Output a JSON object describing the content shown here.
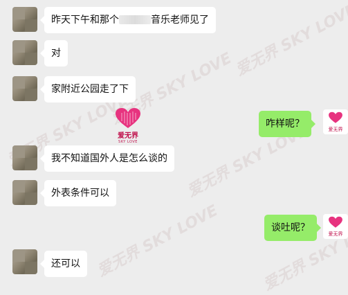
{
  "watermark": {
    "brand_cn": "爱无界",
    "brand_en": "SKY LOVE"
  },
  "center_logo": {
    "title": "爱无界",
    "subtitle": "SKY LOVE"
  },
  "messages": [
    {
      "side": "left",
      "text_before": "昨天下午和那个",
      "redacted": true,
      "text_after": "音乐老师见了"
    },
    {
      "side": "left",
      "text": "对"
    },
    {
      "side": "left",
      "text": "家附近公园走了下"
    },
    {
      "side": "right",
      "text": "咋样呢？",
      "avatar_caption": "爱无界"
    },
    {
      "side": "left",
      "text": "我不知道国外人是怎么谈的"
    },
    {
      "side": "left",
      "text": "外表条件可以"
    },
    {
      "side": "right",
      "text": "谈吐呢？",
      "avatar_caption": "爱无界"
    },
    {
      "side": "left",
      "text": "还可以"
    }
  ],
  "colors": {
    "background": "#ededed",
    "bubble_left": "#ffffff",
    "bubble_right": "#95ec69",
    "logo_pink": "#e7337f"
  }
}
